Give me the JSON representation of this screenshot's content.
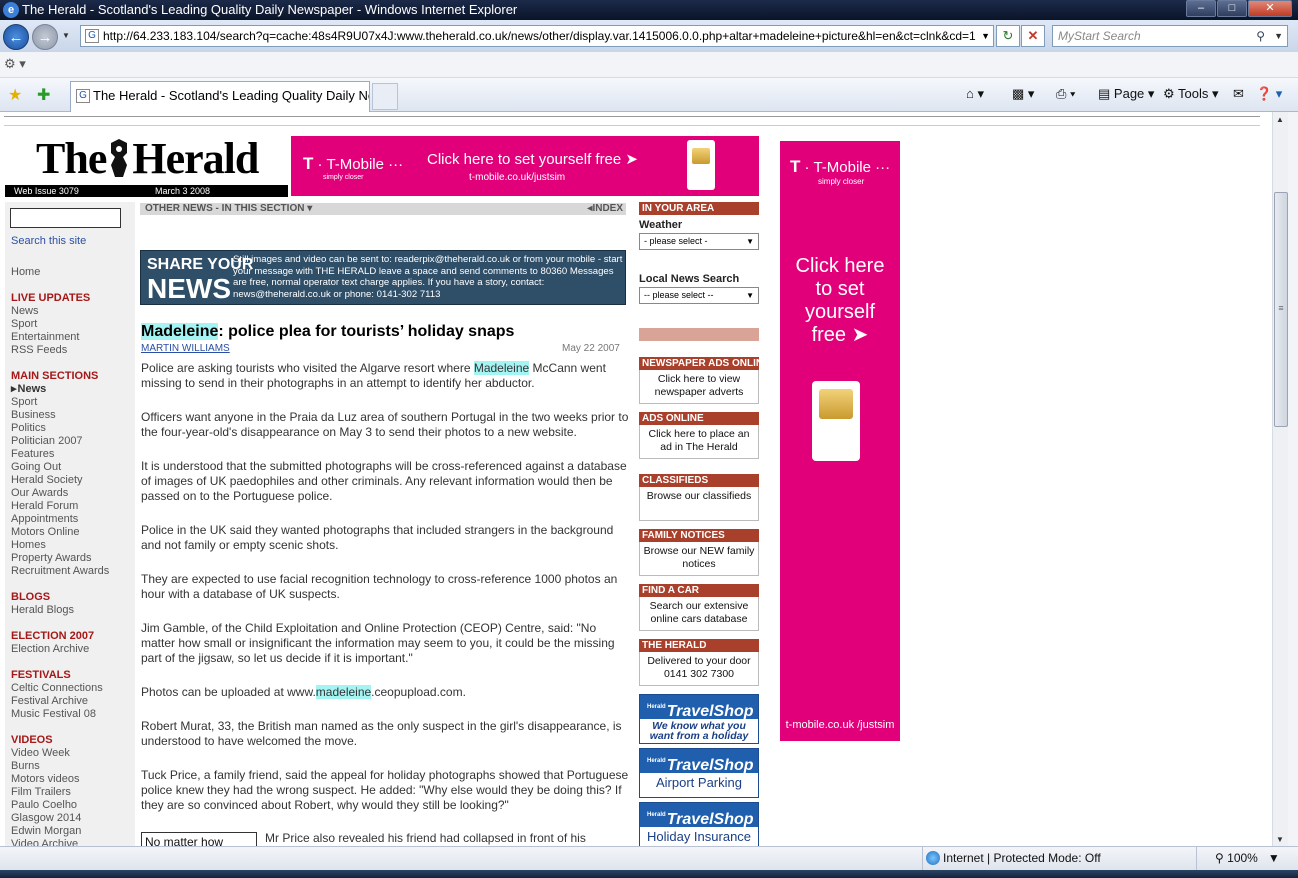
{
  "window": {
    "title": "The Herald - Scotland's Leading Quality Daily Newspaper - Windows Internet Explorer",
    "minimize": "–",
    "maximize": "□",
    "close": "✕"
  },
  "browser": {
    "address": "http://64.233.183.104/search?q=cache:48s4R9U07x4J:www.theherald.co.uk/news/other/display.var.1415006.0.0.php+altar+madeleine+picture&hl=en&ct=clnk&cd=1",
    "search_placeholder": "MyStart Search",
    "tab_label": "The Herald - Scotland's Leading Quality Daily Ne...",
    "cmd_page": "Page",
    "cmd_tools": "Tools",
    "status_zone": "Internet | Protected Mode: Off",
    "zoom": "100%"
  },
  "masthead": {
    "logo_left": "The",
    "logo_right": "Herald",
    "issue": "Web Issue 3079",
    "date": "March 3 2008"
  },
  "banner": {
    "brand": "T-Mobile",
    "tagline": "simply closer",
    "cta": "Click here to set yourself free",
    "url": "t-mobile.co.uk/justsim"
  },
  "skyscraper": {
    "brand": "T-Mobile",
    "tagline": "simply closer",
    "cta": "Click here to set yourself free",
    "url": "t-mobile.co.uk /justsim"
  },
  "leftnav": {
    "search_link": "Search this site",
    "home": "Home",
    "live_updates": {
      "heading": "LIVE UPDATES",
      "items": [
        "News",
        "Sport",
        "Entertainment",
        "RSS Feeds"
      ]
    },
    "main_sections": {
      "heading": "MAIN SECTIONS",
      "active": "News",
      "items": [
        "Sport",
        "Business",
        "Politics",
        "Politician 2007",
        "Features",
        "Going Out",
        "Herald Society",
        "Our Awards",
        "Herald Forum",
        "Appointments",
        "Motors Online",
        "Homes",
        "Property Awards",
        "Recruitment Awards"
      ]
    },
    "blogs": {
      "heading": "BLOGS",
      "items": [
        "Herald Blogs"
      ]
    },
    "election": {
      "heading": "ELECTION 2007",
      "items": [
        "Election Archive"
      ]
    },
    "festivals": {
      "heading": "FESTIVALS",
      "items": [
        "Celtic Connections",
        "Festival Archive",
        "Music Festival 08"
      ]
    },
    "videos": {
      "heading": "VIDEOS",
      "items": [
        "Video Week",
        "Burns",
        "Motors videos",
        "Film Trailers",
        "Paulo Coelho",
        "Glasgow 2014",
        "Edwin Morgan",
        "Video Archive"
      ]
    }
  },
  "article": {
    "other_news": "OTHER NEWS - IN THIS SECTION",
    "index": "INDEX",
    "share_line1": "SHARE YOUR",
    "share_line2": "NEWS",
    "share_text": "Still images and video can be sent to: readerpix@theherald.co.uk or from your mobile - start your message with THE HERALD leave a space and send comments to 80360 Messages are free, normal operator text charge applies. If you have a story, contact: news@theherald.co.uk or phone: 0141-302 7113",
    "headline_hl": "Madeleine",
    "headline_rest": ": police plea for tourists’ holiday snaps",
    "byline": "MARTIN WILLIAMS",
    "pubdate": "May 22 2007",
    "p1_a": "Police are asking tourists who visited the Algarve resort where ",
    "p1_hl": "Madeleine",
    "p1_b": " McCann went missing to send in their photographs in an attempt to identify her abductor.",
    "p2": "Officers want anyone in the Praia da Luz area of southern Portugal in the two weeks prior to the four-year-old's disappearance on May 3 to send their photos to a new website.",
    "p3": "It is understood that the submitted photographs will be cross-referenced against a database of images of UK paedophiles and other criminals. Any relevant information would then be passed on to the Portuguese police.",
    "p4": "Police in the UK said they wanted photographs that included strangers in the background and not family or empty scenic shots.",
    "p5": "They are expected to use facial recognition technology to cross-reference 1000 photos an hour with a database of UK suspects.",
    "p6": "Jim Gamble, of the Child Exploitation and Online Protection (CEOP) Centre, said: \"No matter how small or insignificant the information may seem to you, it could be the missing part of the jigsaw, so let us decide if it is important.\"",
    "p7_a": "Photos can be uploaded at www.",
    "p7_hl": "madeleine",
    "p7_b": ".ceopupload.com.",
    "p8": "Robert Murat, 33, the British man named as the only suspect in the girl's disappearance, is understood to have welcomed the move.",
    "p9": "Tuck Price, a family friend, said the appeal for holiday photographs showed that Portuguese police knew they had the wrong suspect. He added: \"Why else would they be doing this? If they are so convinced about Robert, why would they still be looking?\"",
    "pullquote": "No matter how",
    "p10": "Mr Price also revealed his friend had collapsed in front of his"
  },
  "rightcol": {
    "in_your_area": "IN YOUR AREA",
    "weather_label": "Weather",
    "weather_select": "- please select -",
    "local_label": "Local News Search",
    "local_select": "-- please select --",
    "boxes": [
      {
        "head": "NEWSPAPER ADS ONLINE",
        "text": "Click here to view newspaper adverts"
      },
      {
        "head": "ADS ONLINE",
        "text": "Click here to place an ad in The Herald"
      },
      {
        "head": "CLASSIFIEDS",
        "text": "Browse our classifieds"
      },
      {
        "head": "FAMILY NOTICES",
        "text": "Browse our NEW family notices"
      },
      {
        "head": "FIND A CAR",
        "text": "Search our extensive online cars database"
      },
      {
        "head": "THE HERALD",
        "text": "Delivered to your door 0141 302 7300"
      }
    ],
    "travel_brand": "Travel",
    "travel_brand2": "Shop",
    "travel_prefix": "Herald",
    "travel_sub1": "We know what you want from a holiday",
    "travel_sub2": "Airport Parking",
    "travel_sub3": "Holiday Insurance"
  }
}
